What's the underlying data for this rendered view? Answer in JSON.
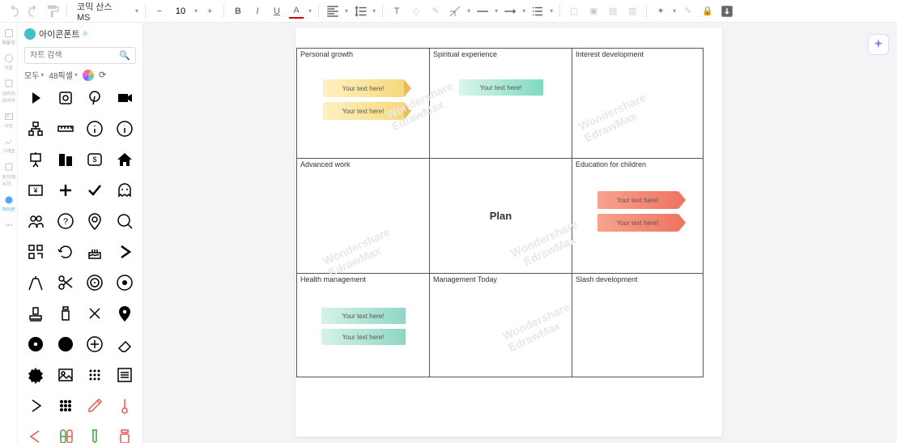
{
  "toolbar": {
    "font": "코믹 산스 MS",
    "size": "10"
  },
  "sidebar": {
    "items": [
      {
        "label": "템플릿"
      },
      {
        "label": "기호"
      },
      {
        "label": "내라이브러리"
      },
      {
        "label": "사진"
      },
      {
        "label": "그래프"
      },
      {
        "label": "문자메시지"
      },
      {
        "label": "아이콘"
      },
      {
        "label": ""
      }
    ]
  },
  "iconPanel": {
    "title": "아이콘폰트",
    "searchPlaceholder": "차트 검색",
    "filter1": "모두",
    "filter2": "48픽셀"
  },
  "cells": {
    "c1": "Personal growth",
    "c2": "Spiritual experience",
    "c3": "Interest development",
    "c4": "Advanced work",
    "c5": "Plan",
    "c6": "Education for children",
    "c7": "Health management",
    "c8": "Management Today",
    "c9": "Slash development"
  },
  "notes": {
    "ytxt": "Your text here!",
    "wm": "Wondershare\nEdrawMax"
  }
}
